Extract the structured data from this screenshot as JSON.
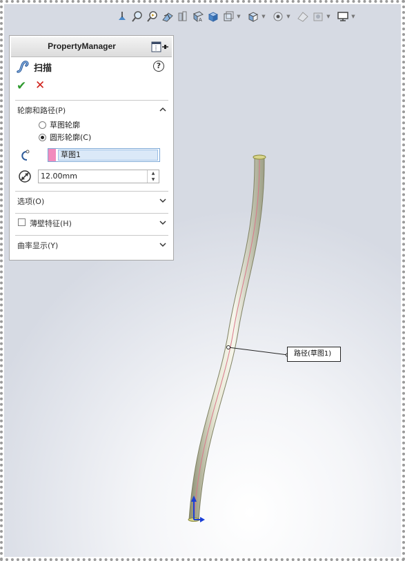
{
  "hud_toolbar": {
    "icons": [
      "zoom-to-fit-icon",
      "zoom-area-icon",
      "previous-view-icon",
      "section-view-icon",
      "dynamic-annotation-icon",
      "view-orientation-icon",
      "display-style-icon",
      "hide-show-icon",
      "edit-appearance-icon",
      "apply-scene-icon",
      "view-settings-icon",
      "display-monitor-icon"
    ]
  },
  "property_manager": {
    "title": "PropertyManager",
    "feature_name": "扫描",
    "help_symbol": "?",
    "ok_symbol": "✔",
    "cancel_symbol": "✕",
    "profile_group": {
      "title": "轮廓和路径(P)",
      "options": [
        {
          "label": "草图轮廓",
          "selected": false
        },
        {
          "label": "圆形轮廓(C)",
          "selected": true
        }
      ],
      "path_selection": "草图1",
      "diameter_value": "12.00mm"
    },
    "groups": [
      {
        "title": "选项(O)"
      },
      {
        "title": "薄壁特征(H)",
        "checkbox": true,
        "checked": false
      },
      {
        "title": "曲率显示(Y)"
      }
    ]
  },
  "graphics": {
    "callout_label": "路径(草图1)"
  },
  "colors": {
    "swatch": "#f18bbd",
    "ok": "#2f9a2f",
    "cancel": "#d0201a",
    "selection": "#dbe9f8"
  }
}
